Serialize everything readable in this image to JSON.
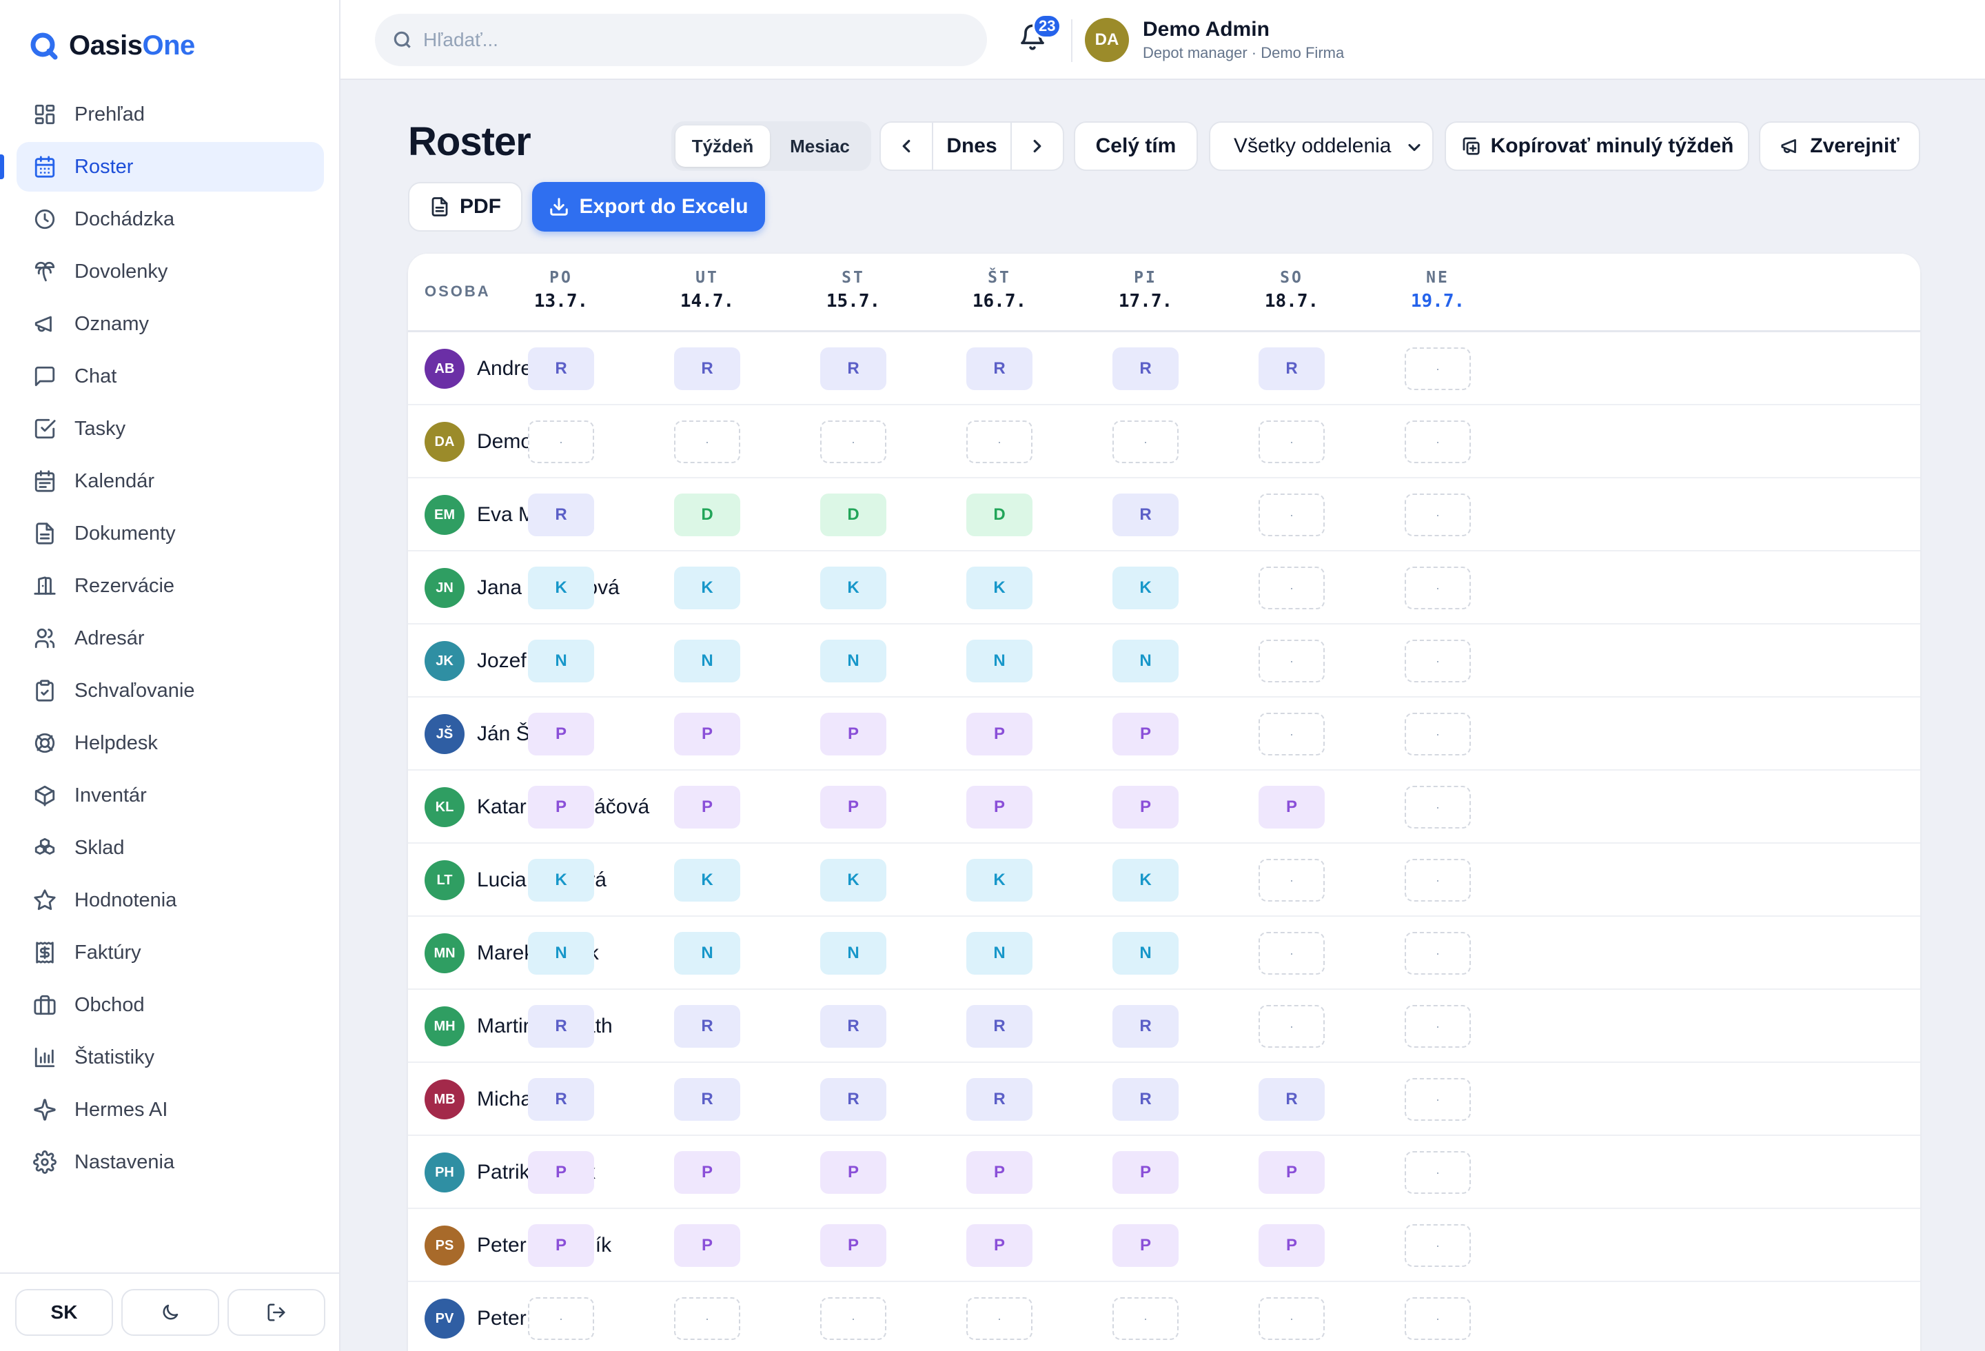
{
  "app": {
    "logo_prefix": "Oasis",
    "logo_accent": "One"
  },
  "sidebar": {
    "items": [
      {
        "label": "Prehľad",
        "icon": "dashboard-icon"
      },
      {
        "label": "Roster",
        "icon": "calendar-grid-icon",
        "active": true
      },
      {
        "label": "Dochádzka",
        "icon": "clock-icon"
      },
      {
        "label": "Dovolenky",
        "icon": "palm-tree-icon"
      },
      {
        "label": "Oznamy",
        "icon": "megaphone-icon"
      },
      {
        "label": "Chat",
        "icon": "chat-icon"
      },
      {
        "label": "Tasky",
        "icon": "checkbox-icon"
      },
      {
        "label": "Kalendár",
        "icon": "calendar-icon"
      },
      {
        "label": "Dokumenty",
        "icon": "document-icon"
      },
      {
        "label": "Rezervácie",
        "icon": "door-icon"
      },
      {
        "label": "Adresár",
        "icon": "users-icon"
      },
      {
        "label": "Schvaľovanie",
        "icon": "clipboard-check-icon"
      },
      {
        "label": "Helpdesk",
        "icon": "lifebuoy-icon"
      },
      {
        "label": "Inventár",
        "icon": "box-icon"
      },
      {
        "label": "Sklad",
        "icon": "boxes-icon"
      },
      {
        "label": "Hodnotenia",
        "icon": "star-icon"
      },
      {
        "label": "Faktúry",
        "icon": "invoice-icon"
      },
      {
        "label": "Obchod",
        "icon": "briefcase-icon"
      },
      {
        "label": "Štatistiky",
        "icon": "bar-chart-icon"
      },
      {
        "label": "Hermes AI",
        "icon": "sparkles-icon"
      },
      {
        "label": "Nastavenia",
        "icon": "gear-icon"
      }
    ],
    "footer": {
      "language": "SK",
      "theme_icon": "moon-icon",
      "logout_icon": "logout-icon"
    }
  },
  "topbar": {
    "search_placeholder": "Hľadať...",
    "notifications_count": "23",
    "user": {
      "initials": "DA",
      "name": "Demo Admin",
      "role": "Depot manager · Demo Firma"
    }
  },
  "toolbar": {
    "title": "Roster",
    "view_week": "Týždeň",
    "view_month": "Mesiac",
    "today": "Dnes",
    "team": "Celý tím",
    "department": "Všetky oddelenia",
    "copy_week": "Kopírovať minulý týždeň",
    "publish": "Zverejniť",
    "pdf": "PDF",
    "export_excel": "Export do Excelu"
  },
  "table": {
    "person_header": "OSOBA",
    "days": [
      {
        "name": "PO",
        "date": "13.7."
      },
      {
        "name": "UT",
        "date": "14.7."
      },
      {
        "name": "ST",
        "date": "15.7."
      },
      {
        "name": "ŠT",
        "date": "16.7."
      },
      {
        "name": "PI",
        "date": "17.7."
      },
      {
        "name": "SO",
        "date": "18.7."
      },
      {
        "name": "NE",
        "date": "19.7.",
        "today": true
      }
    ],
    "empty_mark": "·",
    "rows": [
      {
        "initials": "AB",
        "name": "Andrej Beňo",
        "color": "#6b2fa6",
        "shifts": [
          "R",
          "R",
          "R",
          "R",
          "R",
          "R",
          ""
        ]
      },
      {
        "initials": "DA",
        "name": "Demo Admin",
        "color": "#9b8b2a",
        "shifts": [
          "",
          "",
          "",
          "",
          "",
          "",
          ""
        ]
      },
      {
        "initials": "EM",
        "name": "Eva Malá",
        "color": "#2f9e62",
        "shifts": [
          "R",
          "D",
          "D",
          "D",
          "R",
          "",
          ""
        ]
      },
      {
        "initials": "JN",
        "name": "Jana Nováková",
        "color": "#2f9e62",
        "shifts": [
          "K",
          "K",
          "K",
          "K",
          "K",
          "",
          ""
        ]
      },
      {
        "initials": "JK",
        "name": "Jozef Král",
        "color": "#2f8fa3",
        "shifts": [
          "N",
          "N",
          "N",
          "N",
          "N",
          "",
          ""
        ]
      },
      {
        "initials": "JŠ",
        "name": "Ján Šimko",
        "color": "#2f5ea3",
        "shifts": [
          "P",
          "P",
          "P",
          "P",
          "P",
          "",
          ""
        ]
      },
      {
        "initials": "KL",
        "name": "Katarína Lukáčová",
        "color": "#2f9e62",
        "shifts": [
          "P",
          "P",
          "P",
          "P",
          "P",
          "P",
          ""
        ]
      },
      {
        "initials": "LT",
        "name": "Lucia Tóthová",
        "color": "#2f9e62",
        "shifts": [
          "K",
          "K",
          "K",
          "K",
          "K",
          "",
          ""
        ]
      },
      {
        "initials": "MN",
        "name": "Marek Novák",
        "color": "#2f9e62",
        "shifts": [
          "N",
          "N",
          "N",
          "N",
          "N",
          "",
          ""
        ]
      },
      {
        "initials": "MH",
        "name": "Martin Horváth",
        "color": "#2f9e62",
        "shifts": [
          "R",
          "R",
          "R",
          "R",
          "R",
          "",
          ""
        ]
      },
      {
        "initials": "MB",
        "name": "Michal Baláž",
        "color": "#a3294a",
        "shifts": [
          "R",
          "R",
          "R",
          "R",
          "R",
          "R",
          ""
        ]
      },
      {
        "initials": "PH",
        "name": "Patrik Hudák",
        "color": "#2f8fa3",
        "shifts": [
          "P",
          "P",
          "P",
          "P",
          "P",
          "P",
          ""
        ]
      },
      {
        "initials": "PS",
        "name": "Peter Skladník",
        "color": "#a86a2a",
        "shifts": [
          "P",
          "P",
          "P",
          "P",
          "P",
          "P",
          ""
        ]
      },
      {
        "initials": "PV",
        "name": "Peter Varga",
        "color": "#2f5ea3",
        "shifts": [
          "",
          "",
          "",
          "",
          "",
          "",
          ""
        ]
      }
    ]
  },
  "colors": {
    "accent": "#2f6ff0",
    "sidebar_active_bg": "#eaf1ff"
  }
}
